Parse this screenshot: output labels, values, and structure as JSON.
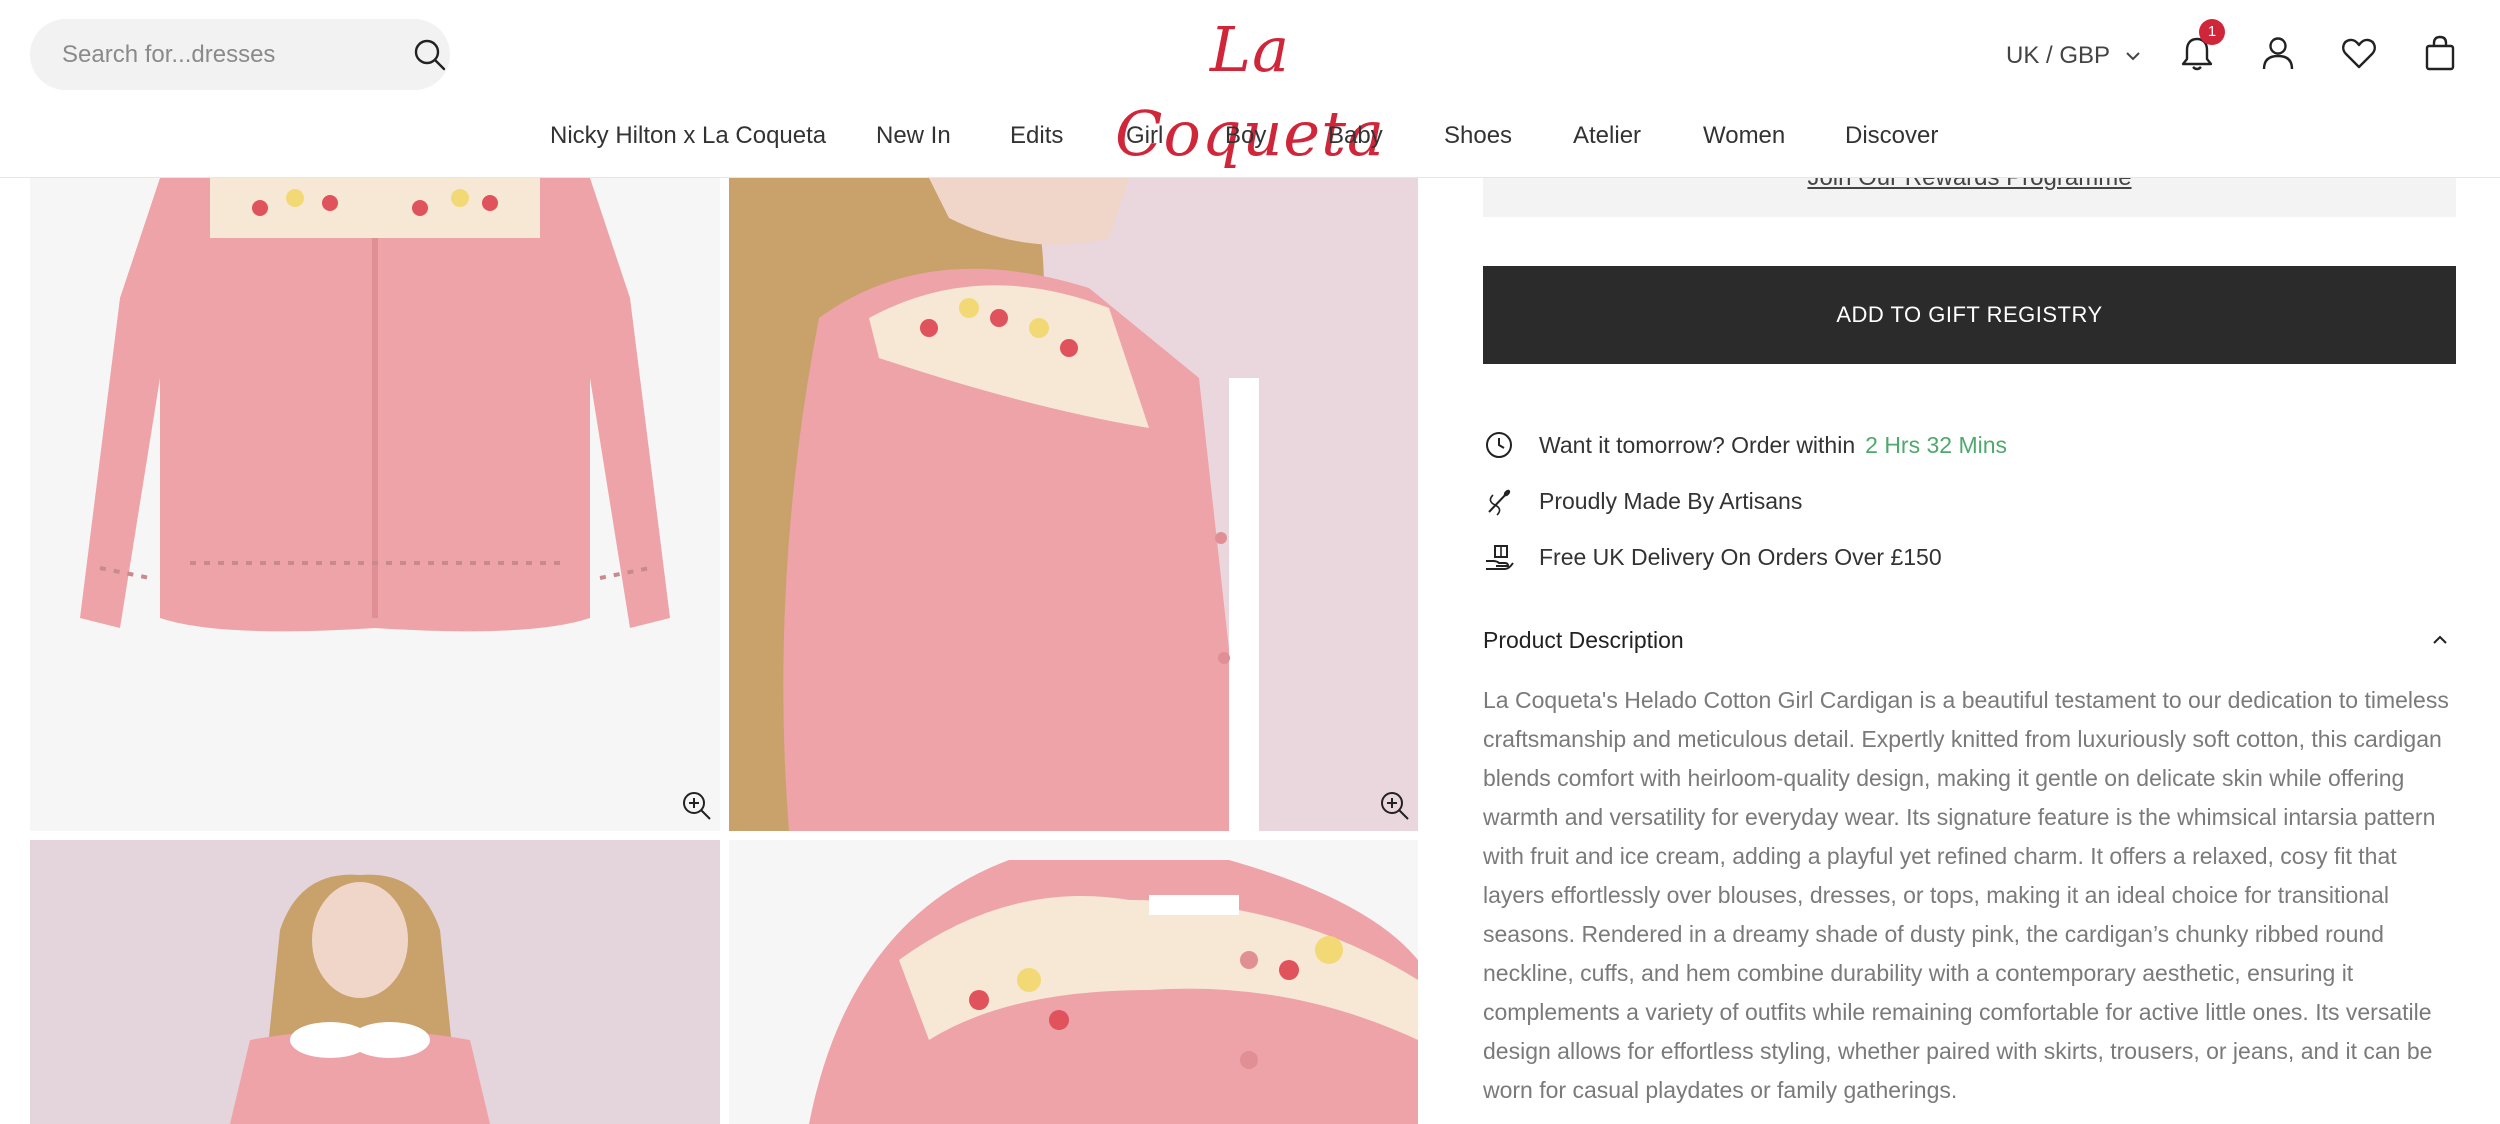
{
  "search": {
    "placeholder": "Search for...dresses"
  },
  "brand": {
    "logo_text": "La Coqueta",
    "accent_color": "#d0263a"
  },
  "header": {
    "currency_label": "UK / GBP",
    "notification_count": "1"
  },
  "nav": {
    "items": [
      "Nicky Hilton x La Coqueta",
      "New In",
      "Edits",
      "Girl",
      "Boy",
      "Baby",
      "Shoes",
      "Atelier",
      "Women",
      "Discover"
    ]
  },
  "product": {
    "rewards_link": "Join Our Rewards Programme",
    "gift_registry_button": "ADD TO GIFT REGISTRY",
    "delivery_prefix": "Want it tomorrow? Order within",
    "delivery_countdown": "2 Hrs 32 Mins",
    "artisans_text": "Proudly Made By Artisans",
    "free_delivery_text": "Free UK Delivery On Orders Over £150",
    "description_title": "Product Description",
    "description": "La Coqueta's Helado Cotton Girl Cardigan is a beautiful testament to our dedication to timeless craftsmanship and meticulous detail. Expertly knitted from luxuriously soft cotton, this cardigan blends comfort with heirloom-quality design, making it gentle on delicate skin while offering warmth and versatility for everyday wear. Its signature feature is the whimsical intarsia pattern with fruit and ice cream, adding a playful yet refined charm. It offers a relaxed, cosy fit that layers effortlessly over blouses, dresses, or tops, making it an ideal choice for transitional seasons. Rendered in a dreamy shade of dusty pink, the cardigan’s chunky ribbed round neckline, cuffs, and hem combine durability with a contemporary aesthetic, ensuring it complements a variety of outfits while remaining comfortable for active little ones. Its versatile design allows for effortless styling, whether paired with skirts, trousers, or jeans, and it can be worn for casual playdates or family gatherings."
  },
  "colors": {
    "countdown_green": "#4fa86e",
    "button_dark": "#2b2b2b",
    "cardigan_pink": "#eea3a8"
  }
}
